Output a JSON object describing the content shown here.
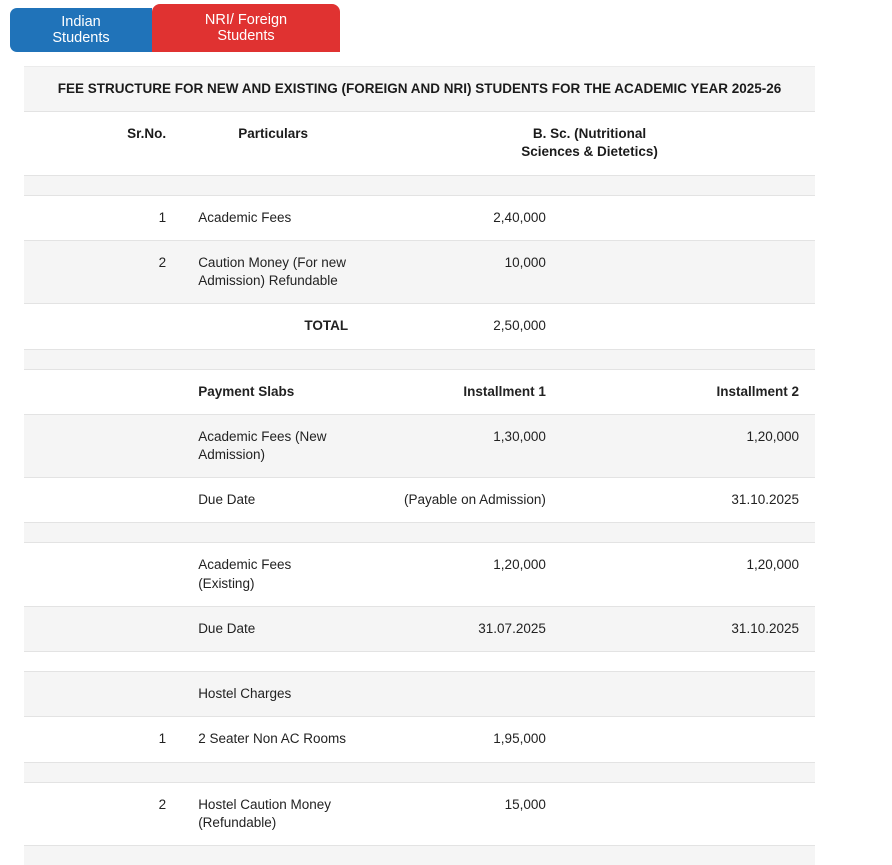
{
  "tabs": [
    {
      "label": "Indian Students",
      "color": "#2073b9",
      "active": false
    },
    {
      "label": "NRI/ Foreign Students",
      "color": "#e03231",
      "active": true
    }
  ],
  "table": {
    "title": "FEE STRUCTURE FOR NEW AND EXISTING (FOREIGN AND NRI) STUDENTS FOR THE ACADEMIC YEAR 2025-26",
    "columns": [
      "Sr.No.",
      "Particulars",
      "B. Sc. (Nutritional Sciences & Dietetics)"
    ],
    "rows": [
      {
        "type": "spacer"
      },
      {
        "cells": [
          {
            "t": "1"
          },
          {
            "t": "Academic Fees"
          },
          {
            "t": "2,40,000"
          },
          {
            "t": ""
          }
        ]
      },
      {
        "cells": [
          {
            "t": "2"
          },
          {
            "t": "Caution Money (For new Admission) Refundable"
          },
          {
            "t": "10,000"
          },
          {
            "t": ""
          }
        ]
      },
      {
        "cells": [
          {
            "t": ""
          },
          {
            "t": "TOTAL",
            "bold": true,
            "align": "right"
          },
          {
            "t": "2,50,000"
          },
          {
            "t": ""
          }
        ]
      },
      {
        "type": "spacer"
      },
      {
        "cells": [
          {
            "t": ""
          },
          {
            "t": "Payment Slabs",
            "bold": true
          },
          {
            "t": "Installment 1",
            "bold": true
          },
          {
            "t": "Installment 2",
            "bold": true
          }
        ]
      },
      {
        "cells": [
          {
            "t": ""
          },
          {
            "t": "Academic Fees (New Admission)"
          },
          {
            "t": "1,30,000"
          },
          {
            "t": "1,20,000"
          }
        ]
      },
      {
        "cells": [
          {
            "t": ""
          },
          {
            "t": "Due Date"
          },
          {
            "t": "(Payable on Admission)"
          },
          {
            "t": "31.10.2025"
          }
        ]
      },
      {
        "type": "spacer"
      },
      {
        "cells": [
          {
            "t": ""
          },
          {
            "t": "Academic Fees (Existing)"
          },
          {
            "t": "1,20,000"
          },
          {
            "t": "1,20,000"
          }
        ]
      },
      {
        "cells": [
          {
            "t": ""
          },
          {
            "t": "Due Date"
          },
          {
            "t": "31.07.2025"
          },
          {
            "t": "31.10.2025"
          }
        ]
      },
      {
        "type": "spacer"
      },
      {
        "cells": [
          {
            "t": ""
          },
          {
            "t": "Hostel Charges"
          },
          {
            "t": ""
          },
          {
            "t": ""
          }
        ]
      },
      {
        "cells": [
          {
            "t": "1"
          },
          {
            "t": "2 Seater Non AC Rooms"
          },
          {
            "t": "1,95,000"
          },
          {
            "t": ""
          }
        ]
      },
      {
        "type": "spacer"
      },
      {
        "cells": [
          {
            "t": "2"
          },
          {
            "t": "Hostel Caution Money (Refundable)"
          },
          {
            "t": "15,000"
          },
          {
            "t": ""
          }
        ]
      },
      {
        "type": "spacer"
      }
    ]
  },
  "colors": {
    "tab_indian": "#2073b9",
    "tab_nri": "#e03231",
    "tab_text": "#ffffff",
    "row_stripe": "#f5f5f5",
    "row_border": "#e3e3e3",
    "text": "#222222"
  }
}
